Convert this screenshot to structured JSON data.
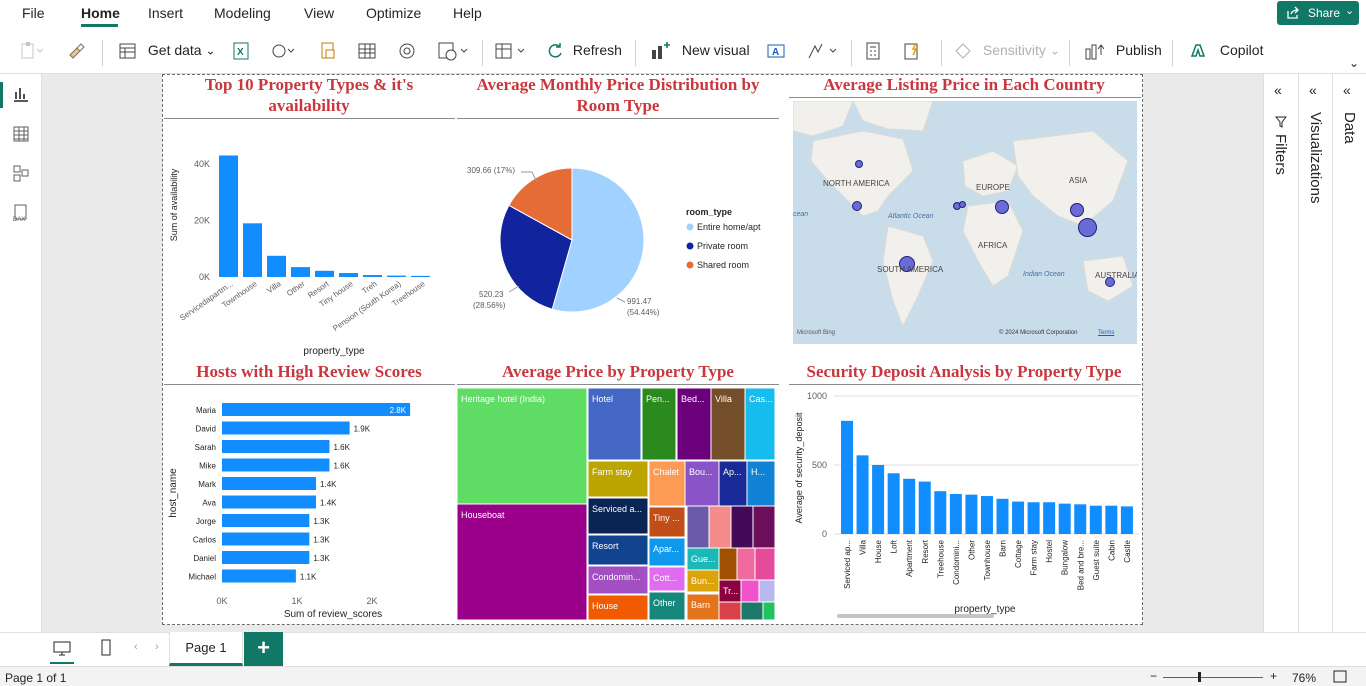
{
  "menu": {
    "items": [
      "File",
      "Home",
      "Insert",
      "Modeling",
      "View",
      "Optimize",
      "Help"
    ],
    "active": "Home",
    "share": "Share"
  },
  "toolbar": {
    "get_data": "Get data",
    "refresh": "Refresh",
    "new_visual": "New visual",
    "sensitivity": "Sensitivity",
    "publish": "Publish",
    "copilot": "Copilot"
  },
  "colors": {
    "accent": "#117865",
    "bar": "#118DFF",
    "title": "#c8373d"
  },
  "visuals": {
    "v1": {
      "title_line1": "Top 10 Property Types & it's",
      "title_line2": "availability"
    },
    "v2": {
      "title_line1": "Average Monthly Price Distribution by",
      "title_line2": "Room Type"
    },
    "v3": {
      "title": "Average Listing Price in Each Country"
    },
    "v4": {
      "title": "Hosts with High Review Scores"
    },
    "v5": {
      "title": "Average Price by Property Type"
    },
    "v6": {
      "title": "Security Deposit Analysis by Property Type"
    }
  },
  "map": {
    "labels": [
      "NORTH AMERICA",
      "EUROPE",
      "ASIA",
      "AFRICA",
      "SOUTH AMERICA",
      "AUSTRALIA",
      "Atlantic Ocean",
      "Indian Ocean",
      "cean"
    ],
    "copyright": "© 2024 Microsoft Corporation",
    "terms": "Terms",
    "brand": "Microsoft Bing"
  },
  "pages": {
    "tab": "Page 1",
    "status": "Page 1 of 1",
    "zoom": "76%"
  },
  "panes": {
    "filters": "Filters",
    "visualizations": "Visualizations",
    "data": "Data"
  },
  "chart_data": [
    {
      "type": "bar",
      "title": "",
      "categories": [
        "Serviced apartm...",
        "Townhouse",
        "Villa",
        "Other",
        "Resort",
        "Tiny house",
        "Treehouse",
        "Pension (South Korea)",
        "Treehouse"
      ],
      "category_labels": [
        "Serviced apartm...",
        "Townhouse",
        "Villa",
        "Other",
        "Resort",
        "Tiny house",
        "Treehouse",
        "Pension (South Korea)",
        "Treehouse"
      ],
      "tick_labels": [
        "Servicedapartm...",
        "Townhouse",
        "Villa",
        "Other",
        "Resort",
        "Tiny house",
        "Treh",
        "Pension (South Korea)",
        "Treehouse"
      ],
      "values": [
        43000,
        19000,
        7500,
        3500,
        2200,
        1400,
        700,
        500,
        400
      ],
      "xlabel": "property_type",
      "ylabel": "Sum of availability",
      "yticks": [
        "0K",
        "20K",
        "40K"
      ],
      "ylim": [
        0,
        46000
      ]
    },
    {
      "type": "pie",
      "legend_title": "room_type",
      "slices": [
        {
          "name": "Entire home/apt",
          "value": 991.47,
          "label_value": "991.47",
          "label_pct": "(54.44%)",
          "color": "#A0D1FF"
        },
        {
          "name": "Private room",
          "value": 520.23,
          "label_value": "520.23",
          "label_pct": "(28.56%)",
          "color": "#12239E"
        },
        {
          "name": "Shared room",
          "value": 309.66,
          "label_value": "309.66 (17%)",
          "label_pct": "",
          "color": "#E66C37"
        }
      ]
    },
    {
      "type": "bar",
      "orientation": "horizontal",
      "categories": [
        "Maria",
        "David",
        "Sarah",
        "Mike",
        "Mark",
        "Ava",
        "Jorge",
        "Carlos",
        "Daniel",
        "Michael"
      ],
      "values": [
        2800,
        1900,
        1600,
        1600,
        1400,
        1400,
        1300,
        1300,
        1300,
        1100
      ],
      "labels": [
        "2.8K",
        "1.9K",
        "1.6K",
        "1.6K",
        "1.4K",
        "1.4K",
        "1.3K",
        "1.3K",
        "1.3K",
        "1.1K"
      ],
      "xlabel": "Sum of review_scores",
      "ylabel": "host_name",
      "xticks": [
        "0K",
        "1K",
        "2K"
      ],
      "xlim": [
        0,
        3000
      ]
    },
    {
      "type": "treemap",
      "items": [
        {
          "label": "Heritage hotel (India)",
          "color": "#5EDC64"
        },
        {
          "label": "Houseboat",
          "color": "#9A0089"
        },
        {
          "label": "Hotel",
          "color": "#4467C4"
        },
        {
          "label": "Pen...",
          "color": "#2A8A1E"
        },
        {
          "label": "Bed...",
          "color": "#6B007B"
        },
        {
          "label": "Villa",
          "color": "#744E29"
        },
        {
          "label": "Cas...",
          "color": "#17BCEF"
        },
        {
          "label": "Farm stay",
          "color": "#BDA500"
        },
        {
          "label": "Chalet",
          "color": "#FD9A53"
        },
        {
          "label": "Bou...",
          "color": "#8954C8"
        },
        {
          "label": "Ap...",
          "color": "#1A2A96"
        },
        {
          "label": "H...",
          "color": "#1182D6"
        },
        {
          "label": "Serviced a...",
          "color": "#0A2453"
        },
        {
          "label": "Tiny ...",
          "color": "#C14D18"
        },
        {
          "label": "Resort",
          "color": "#11438F"
        },
        {
          "label": "Apar...",
          "color": "#0F99EC"
        },
        {
          "label": "Condomin...",
          "color": "#A24FC1"
        },
        {
          "label": "Gue...",
          "color": "#1AB9B8"
        },
        {
          "label": "Cott...",
          "color": "#E06DF1"
        },
        {
          "label": "Bun...",
          "color": "#DAA40A"
        },
        {
          "label": "Tr...",
          "color": "#8B0041"
        },
        {
          "label": "House",
          "color": "#F15B00"
        },
        {
          "label": "Other",
          "color": "#16877B"
        },
        {
          "label": "Barn",
          "color": "#E4731E"
        }
      ]
    },
    {
      "type": "bar",
      "categories": [
        "Serviced ap...",
        "Villa",
        "House",
        "Loft",
        "Apartment",
        "Resort",
        "Treehouse",
        "Condomini...",
        "Other",
        "Townhouse",
        "Barn",
        "Cottage",
        "Farm stay",
        "Hostel",
        "Bungalow",
        "Bed and bre...",
        "Guest suite",
        "Cabin",
        "Castle"
      ],
      "values": [
        820,
        570,
        500,
        440,
        400,
        380,
        310,
        290,
        285,
        275,
        255,
        235,
        230,
        230,
        220,
        215,
        205,
        205,
        200
      ],
      "xlabel": "property_type",
      "ylabel": "Average of security_deposit",
      "yticks": [
        "0",
        "500",
        "1000"
      ],
      "ylim": [
        0,
        1000
      ]
    }
  ]
}
